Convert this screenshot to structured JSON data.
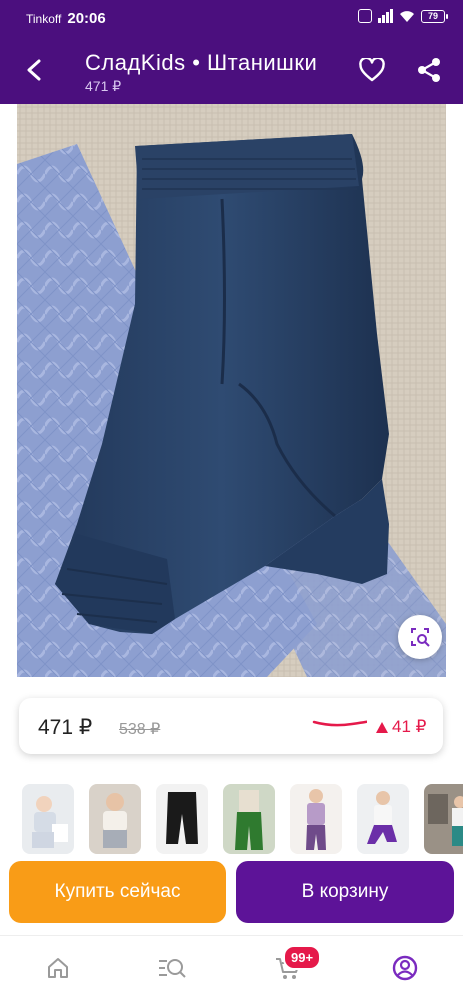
{
  "status_bar": {
    "carrier": "Tinkoff",
    "time": "20:06",
    "battery": "79"
  },
  "header": {
    "title": "СладKids • Штанишки",
    "subtitle": "471 ₽"
  },
  "price": {
    "current": "471 ₽",
    "old": "538 ₽",
    "change": "41 ₽",
    "change_color": "#e5194a"
  },
  "actions": {
    "buy_now": "Купить сейчас",
    "add_to_cart": "В корзину",
    "buy_color": "#f99c17",
    "cart_color": "#5d1398"
  },
  "bottom_nav": {
    "cart_badge": "99+",
    "items": [
      "home-icon",
      "catalog-search-icon",
      "cart-icon",
      "profile-icon"
    ]
  },
  "colors": {
    "brand": "#4b0f7e",
    "accent": "#5d1398"
  }
}
